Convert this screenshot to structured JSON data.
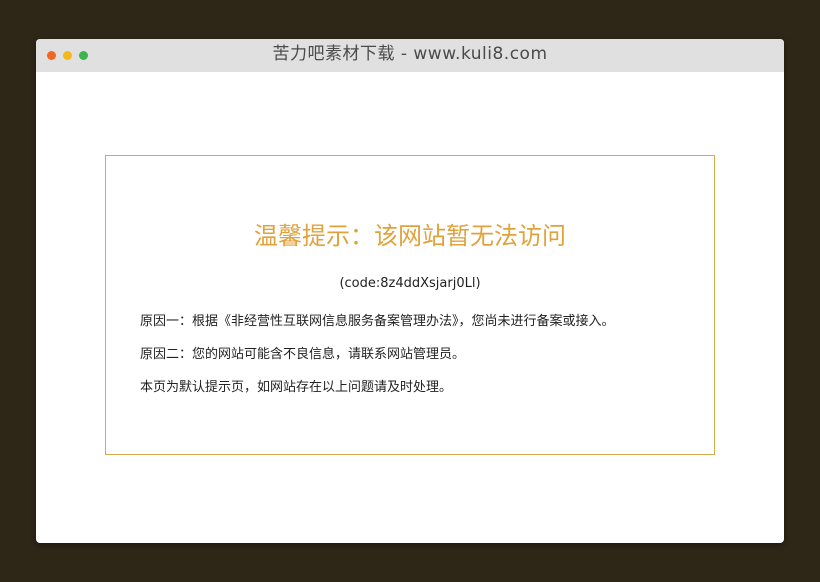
{
  "window": {
    "title": "苦力吧素材下载 - www.kuli8.com",
    "controls": {
      "close_color": "#f26522",
      "minimize_color": "#f5b81a",
      "maximize_color": "#3cb54a"
    }
  },
  "notice": {
    "title": "温馨提示：该网站暂无法访问",
    "code": "(code:8z4ddXsjarj0Ll)",
    "reasons": [
      "原因一：根据《非经营性互联网信息服务备案管理办法》，您尚未进行备案或接入。",
      "原因二：您的网站可能含不良信息，请联系网站管理员。",
      "本页为默认提示页，如网站存在以上问题请及时处理。"
    ]
  },
  "colors": {
    "accent": "#e0a33c",
    "border": "#d9a84e",
    "background": "#2e2617"
  }
}
